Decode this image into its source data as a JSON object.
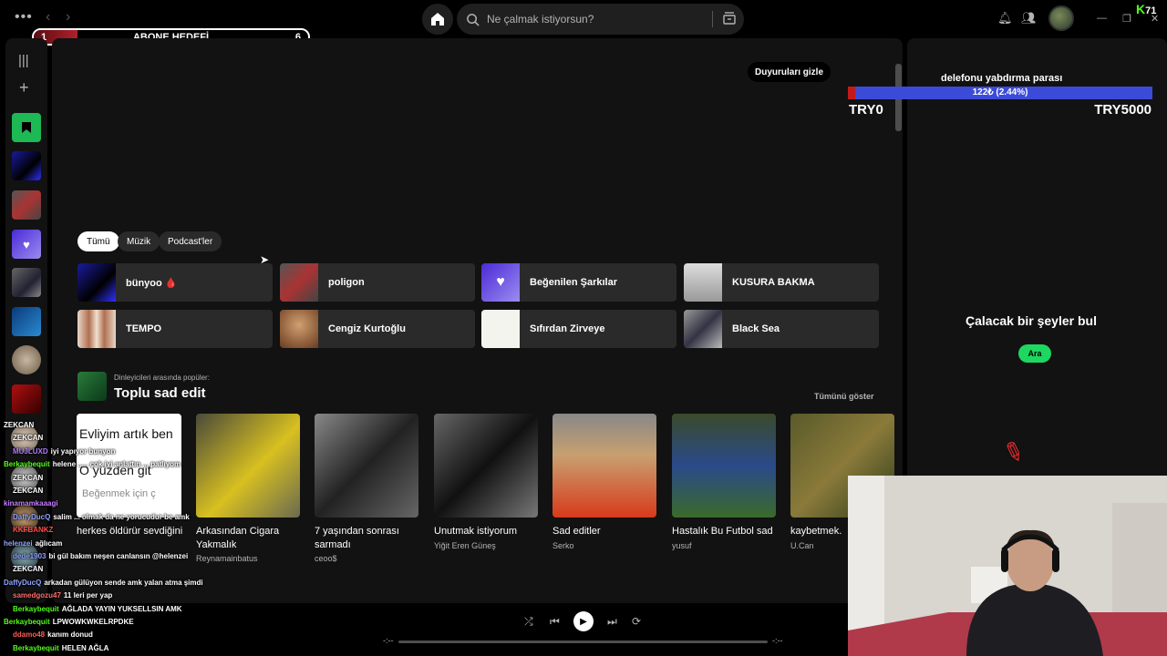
{
  "topbar": {
    "search_placeholder": "Ne çalmak istiyorsun?"
  },
  "goal": {
    "title": "ABONE HEDEFİ",
    "current": "1",
    "target": "6",
    "progress_fraction": 0.16
  },
  "main": {
    "hide_announcements": "Duyuruları gizle",
    "filters": [
      "Tümü",
      "Müzik",
      "Podcast'ler"
    ],
    "quick_access": [
      {
        "label": "bünyoo 🩸"
      },
      {
        "label": "poligon"
      },
      {
        "label": "Beğenilen Şarkılar"
      },
      {
        "label": "KUSURA BAKMA"
      },
      {
        "label": "TEMPO"
      },
      {
        "label": "Cengiz Kurtoğlu"
      },
      {
        "label": "Sıfırdan Zirveye"
      },
      {
        "label": "Black Sea"
      }
    ],
    "section": {
      "subtitle": "Dinleyicileri arasında popüler:",
      "title": "Toplu sad edit",
      "show_all": "Tümünü göster"
    },
    "quote_card": {
      "line1": "Evliyim artık ben",
      "line2": "O yüzden git",
      "line3": "Beğenmek için ç"
    },
    "playlists": [
      {
        "title": "herkes öldürür sevdiğini",
        "owner": ""
      },
      {
        "title": "Arkasından Cigara Yakmalık",
        "owner": "Reynamainbatus"
      },
      {
        "title": "7 yaşından sonrası sarmadı",
        "owner": "ceoo$"
      },
      {
        "title": "Unutmak istiyorum",
        "owner": "Yiğit Eren Güneş"
      },
      {
        "title": "Sad editler",
        "owner": "Serko"
      },
      {
        "title": "Hastalık Bu Futbol sad",
        "owner": "yusuf"
      },
      {
        "title": "kaybetmek.",
        "owner": "U.Can"
      }
    ]
  },
  "right_panel": {
    "find_title": "Çalacak bir şeyler bul",
    "find_button": "Ara"
  },
  "donation": {
    "title": "delefonu yabdırma parası",
    "progress_text": "122₺ (2.44%)",
    "progress_fraction": 0.0244,
    "min": "TRY0",
    "max": "TRY5000"
  },
  "player": {
    "elapsed": "-:--",
    "total": "-:--"
  },
  "chat": [
    {
      "user": "ZEKCAN",
      "msg": "",
      "color": "#ffffff"
    },
    {
      "user": "ZEKCAN",
      "msg": "",
      "color": "#ffffff"
    },
    {
      "user": "MUJLUXD",
      "msg": "iyi yapıyor bunyon",
      "color": "#b07cff"
    },
    {
      "user": "Berkaybequit",
      "msg": "helene ..... çok iyi anlattın ... patlıyom",
      "color": "#53fc18"
    },
    {
      "user": "ZEKCAN",
      "msg": "",
      "color": "#ffffff"
    },
    {
      "user": "ZEKCAN",
      "msg": "",
      "color": "#ffffff"
    },
    {
      "user": "kinamamkaaagi",
      "msg": "",
      "color": "#c77dff"
    },
    {
      "user": "DaffyDucQ",
      "msg": "salim ... olmak da ne yorucudur be amk",
      "color": "#8fa4ff"
    },
    {
      "user": "KKFBANKZ",
      "msg": "",
      "color": "#ff4d4d"
    },
    {
      "user": "helenzei",
      "msg": "ağlıcam",
      "color": "#8fa4ff"
    },
    {
      "user": "dede1903",
      "msg": "bi gül bakım neşen canlansın @helenzei",
      "color": "#8fa4ff"
    },
    {
      "user": "ZEKCAN",
      "msg": "",
      "color": "#ffffff"
    },
    {
      "user": "DaffyDucQ",
      "msg": "arkadan gülüyon sende amk yalan atma şimdi",
      "color": "#8fa4ff"
    },
    {
      "user": "samedgozu47",
      "msg": "11 leri per yap",
      "color": "#ff6b6b"
    },
    {
      "user": "Berkaybequit",
      "msg": "AĞLADA YAYIN YUKSELLSIN AMK",
      "color": "#53fc18"
    },
    {
      "user": "Berkaybequit",
      "msg": "LPWOWKWKELRPDKE",
      "color": "#53fc18"
    },
    {
      "user": "ddamo48",
      "msg": "kanım donud",
      "color": "#ff5a5a"
    },
    {
      "user": "Berkaybequit",
      "msg": "HELEN AĞLA",
      "color": "#53fc18"
    }
  ],
  "colors": {
    "accent": "#1ed760",
    "kick": "#53fc18",
    "donation_bar": "#3b4bd8",
    "donation_fill": "#c21a1a"
  }
}
